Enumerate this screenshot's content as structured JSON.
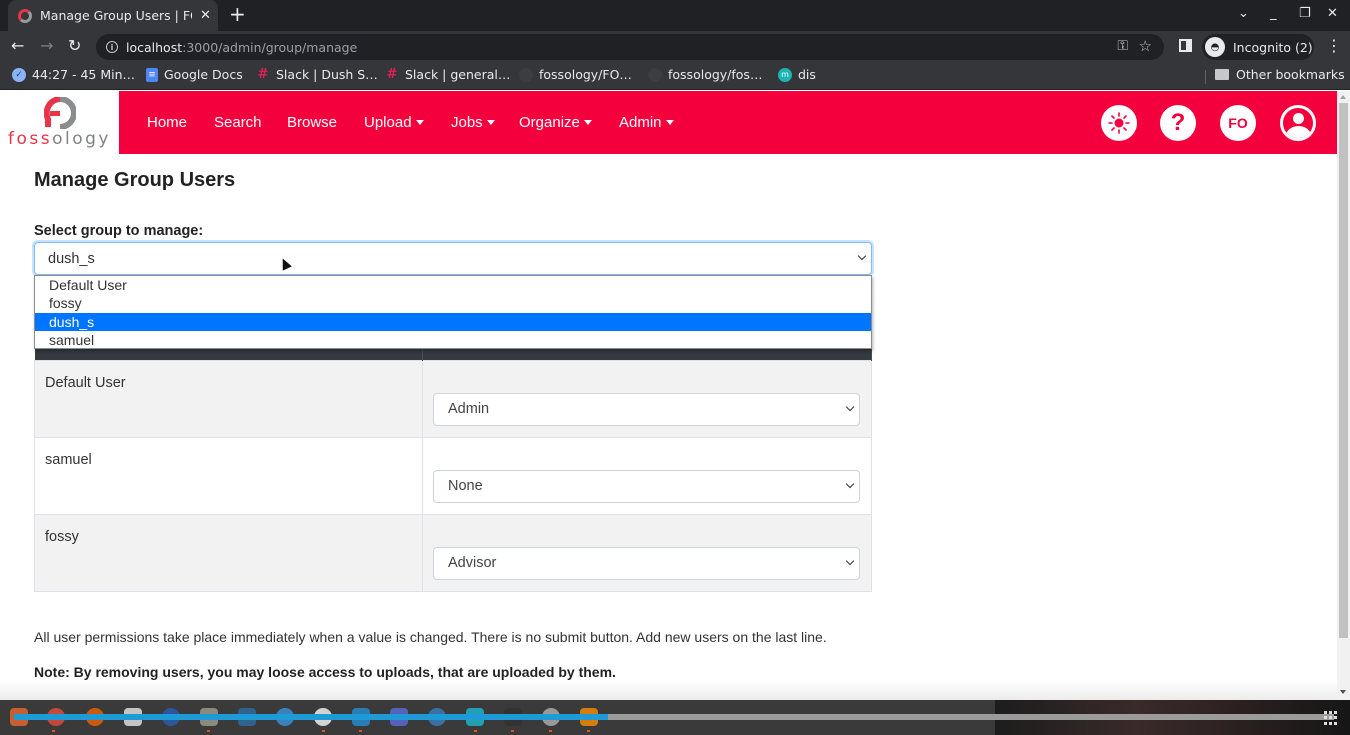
{
  "browser": {
    "tab_title": "Manage Group Users | FOSSology",
    "new_tab_icon": "plus-icon",
    "url_host": "localhost",
    "url_path": ":3000/admin/group/manage",
    "incognito_label": "Incognito (2)",
    "bookmarks": [
      {
        "label": "44:27 - 45 Min…",
        "icon": "timer-icon"
      },
      {
        "label": "Google Docs",
        "icon": "google-docs-icon"
      },
      {
        "label": "Slack | Dush S…",
        "icon": "slack-icon"
      },
      {
        "label": "Slack | general…",
        "icon": "slack-icon"
      },
      {
        "label": "fossology/FO…",
        "icon": "github-icon"
      },
      {
        "label": "fossology/fos…",
        "icon": "github-icon"
      },
      {
        "label": "dis",
        "icon": "meet-icon"
      }
    ],
    "other_bookmarks": "Other bookmarks"
  },
  "app": {
    "brand_prefix": "foss",
    "brand_suffix": "ology",
    "accent_color": "#f4003d",
    "nav": [
      {
        "label": "Home",
        "dropdown": false
      },
      {
        "label": "Search",
        "dropdown": false
      },
      {
        "label": "Browse",
        "dropdown": false
      },
      {
        "label": "Upload",
        "dropdown": true
      },
      {
        "label": "Jobs",
        "dropdown": true
      },
      {
        "label": "Organize",
        "dropdown": true
      },
      {
        "label": "Admin",
        "dropdown": true
      }
    ],
    "header_buttons": {
      "theme": "sun-icon",
      "help": "?",
      "user_initials": "FO",
      "profile": "user-icon"
    }
  },
  "main": {
    "title": "Manage Group Users",
    "group_label": "Select group to manage:",
    "selected_group": "dush_s",
    "group_options": [
      "Default User",
      "fossy",
      "dush_s",
      "samuel"
    ],
    "selected_option_color": "#0075ff",
    "users": [
      {
        "name": "Default User",
        "permission": "Admin"
      },
      {
        "name": "samuel",
        "permission": "None"
      },
      {
        "name": "fossy",
        "permission": "Advisor"
      }
    ],
    "info_text": "All user permissions take place immediately when a value is changed. There is no submit button. Add new users on the last line.",
    "note_text": "Note: By removing users, you may loose access to uploads, that are uploaded by them."
  },
  "taskbar": {
    "progress_percent": 45
  }
}
